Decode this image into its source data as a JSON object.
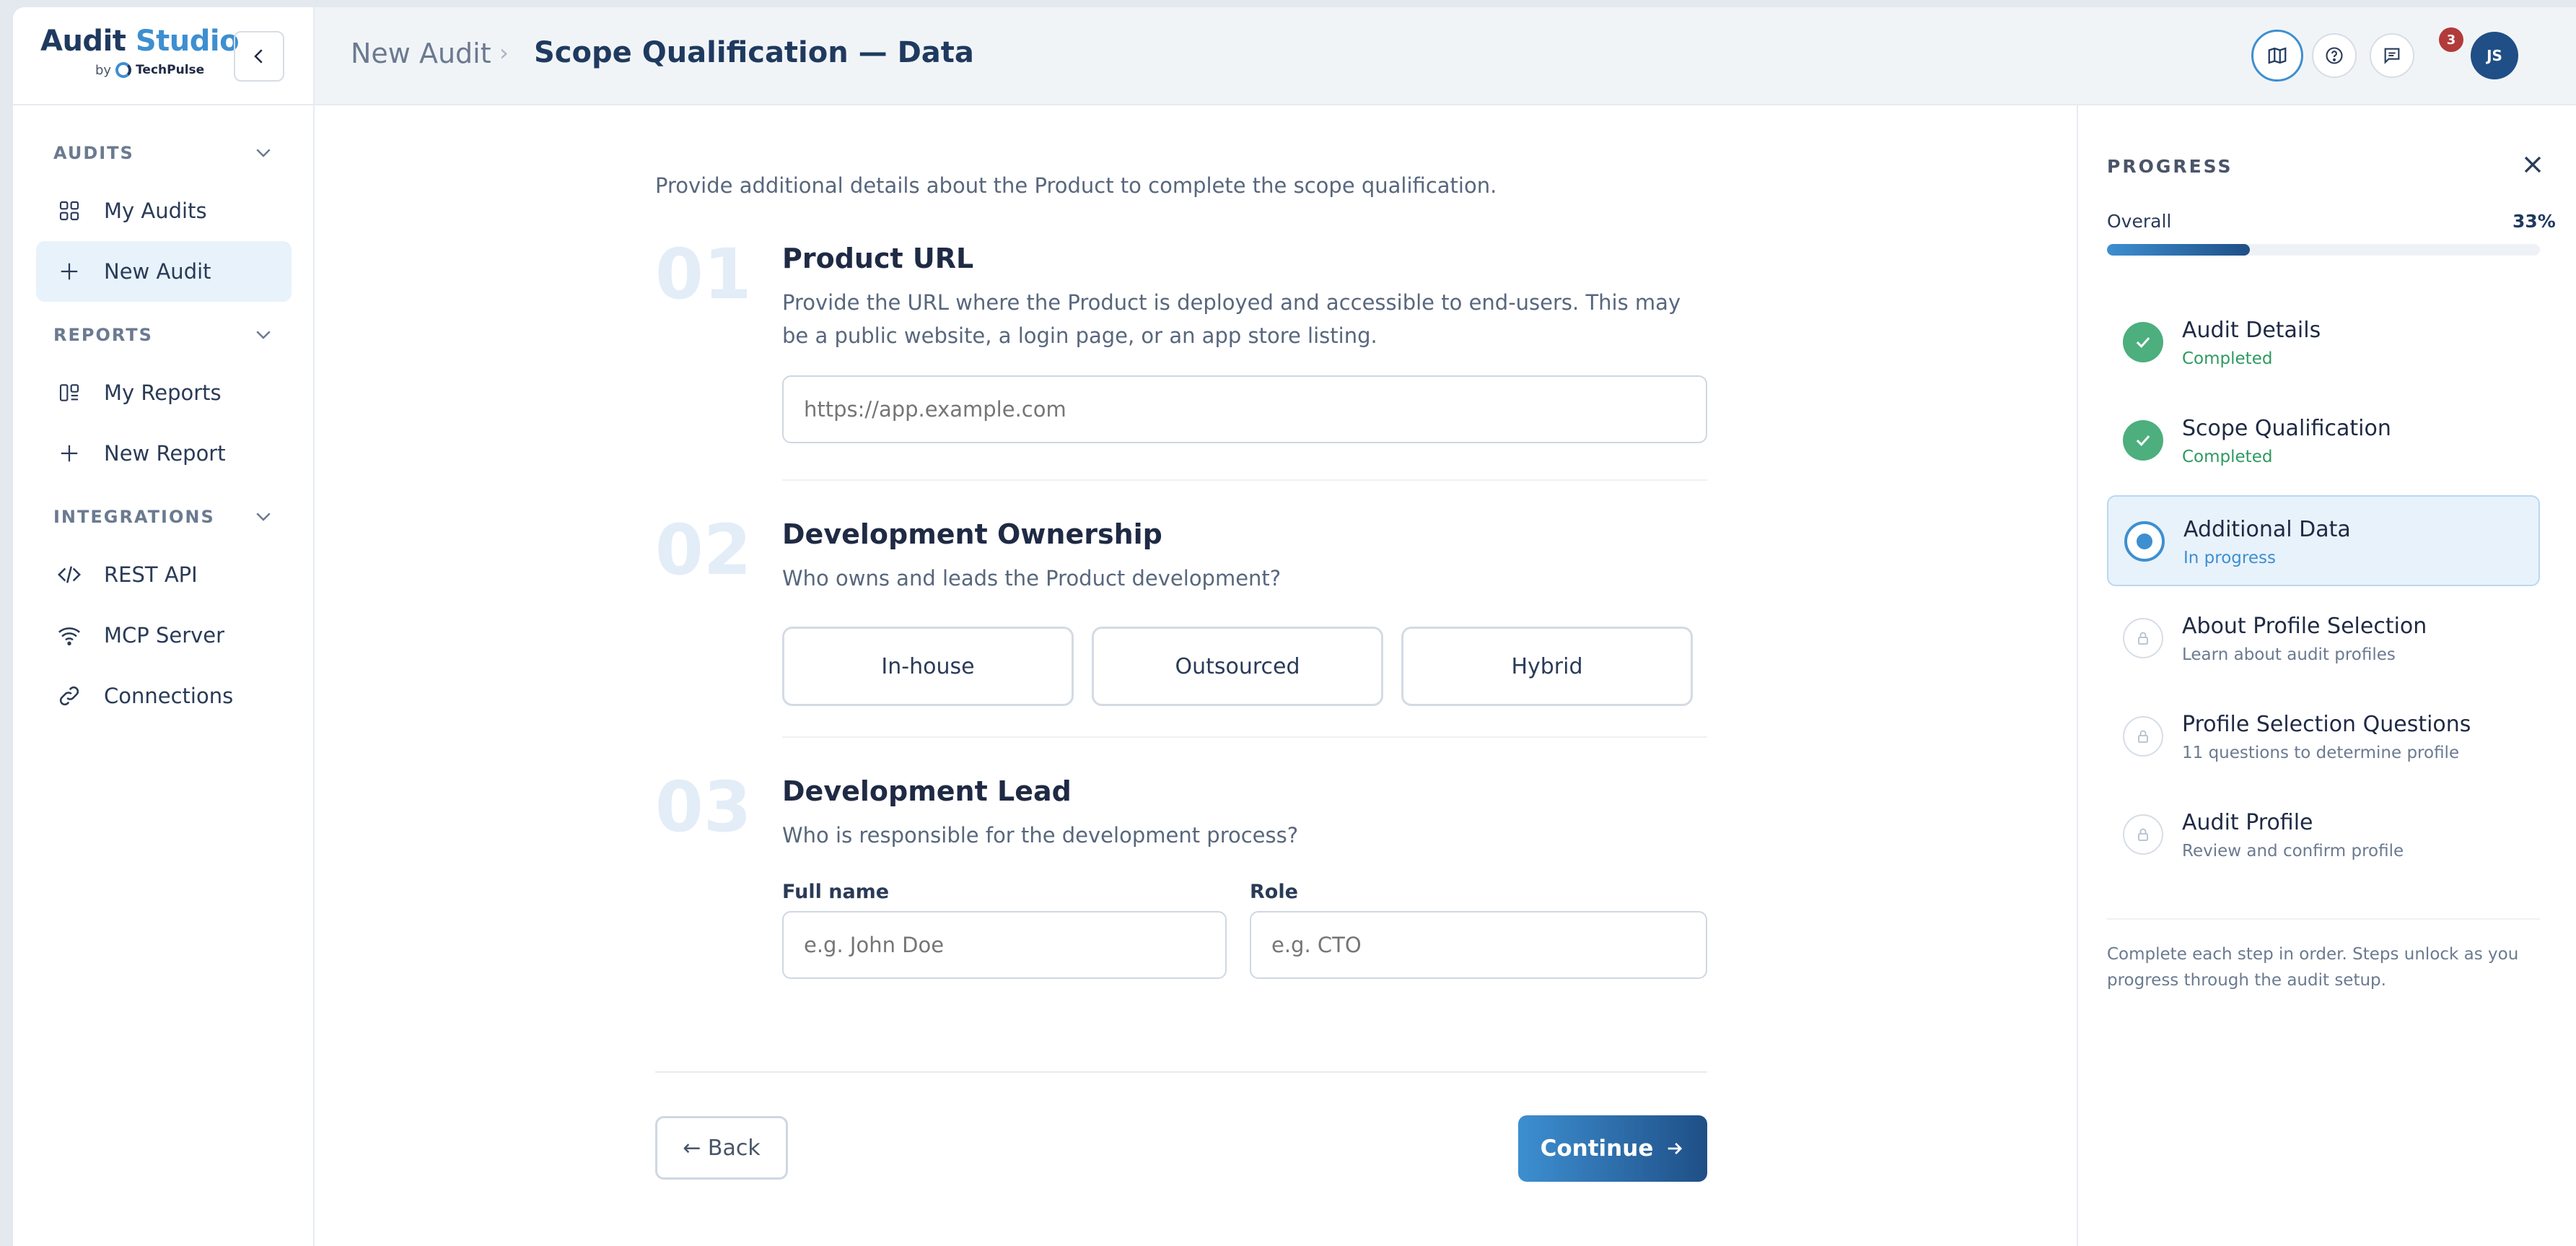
{
  "brand": {
    "title_main": "Audit",
    "title_accent": "Studio",
    "by": "by",
    "company": "TechPulse"
  },
  "sidebar": {
    "sections": [
      {
        "label": "AUDITS",
        "items": [
          {
            "label": "My Audits",
            "icon": "grid-icon"
          },
          {
            "label": "New Audit",
            "icon": "plus-icon",
            "active": true
          }
        ]
      },
      {
        "label": "REPORTS",
        "items": [
          {
            "label": "My Reports",
            "icon": "report-icon"
          },
          {
            "label": "New Report",
            "icon": "plus-icon"
          }
        ]
      },
      {
        "label": "INTEGRATIONS",
        "items": [
          {
            "label": "REST API",
            "icon": "code-icon"
          },
          {
            "label": "MCP Server",
            "icon": "wifi-icon"
          },
          {
            "label": "Connections",
            "icon": "link-icon"
          }
        ]
      }
    ]
  },
  "header": {
    "breadcrumb_parent": "New Audit",
    "breadcrumb_current": "Scope Qualification — Data",
    "notification_count": "3",
    "avatar_initials": "JS"
  },
  "form": {
    "intro": "Provide additional details about the Product to complete the scope qualification.",
    "steps": [
      {
        "number": "01",
        "title": "Product URL",
        "description": "Provide the URL where the Product is deployed and accessible to end-users. This may be a public website, a login page, or an app store listing.",
        "placeholder": "https://app.example.com"
      },
      {
        "number": "02",
        "title": "Development Ownership",
        "description": "Who owns and leads the Product development?",
        "options": [
          "In-house",
          "Outsourced",
          "Hybrid"
        ]
      },
      {
        "number": "03",
        "title": "Development Lead",
        "description": "Who is responsible for the development process?",
        "fields": [
          {
            "label": "Full name",
            "placeholder": "e.g. John Doe"
          },
          {
            "label": "Role",
            "placeholder": "e.g. CTO"
          }
        ]
      }
    ],
    "back_label": "← Back",
    "continue_label": "Continue"
  },
  "progress": {
    "title": "PROGRESS",
    "overall_label": "Overall",
    "overall_pct_text": "33%",
    "overall_fraction": 0.33,
    "steps": [
      {
        "name": "Audit Details",
        "status": "Completed",
        "state": "done"
      },
      {
        "name": "Scope Qualification",
        "status": "Completed",
        "state": "done"
      },
      {
        "name": "Additional Data",
        "status": "In progress",
        "state": "current"
      },
      {
        "name": "About Profile Selection",
        "status": "Learn about audit profiles",
        "state": "locked"
      },
      {
        "name": "Profile Selection Questions",
        "status": "11 questions to determine profile",
        "state": "locked"
      },
      {
        "name": "Audit Profile",
        "status": "Review and confirm profile",
        "state": "locked"
      }
    ],
    "note": "Complete each step in order. Steps unlock as you progress through the audit setup."
  },
  "colors": {
    "accent": "#3d8fd1",
    "brand_dark": "#1f3a5f",
    "success": "#4caf7d",
    "badge": "#b23a3a"
  }
}
